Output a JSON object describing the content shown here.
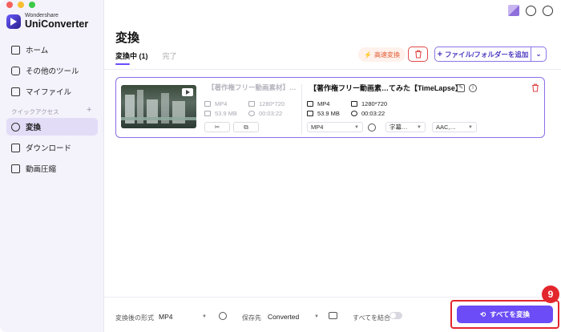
{
  "app": {
    "brand": "Wondershare",
    "product": "UniConverter"
  },
  "colors": {
    "accent": "#6b4cf6",
    "danger": "#e04848",
    "highlight": "#e3262d",
    "fast": "#e15a2f"
  },
  "sidebar": {
    "items": [
      {
        "label": "ホーム",
        "icon": "home-icon"
      },
      {
        "label": "その他のツール",
        "icon": "toolbox-icon"
      },
      {
        "label": "マイファイル",
        "icon": "file-icon"
      },
      {
        "label": "変換",
        "icon": "convert-icon",
        "active": true
      },
      {
        "label": "ダウンロード",
        "icon": "download-icon"
      },
      {
        "label": "動画圧縮",
        "icon": "compress-icon"
      }
    ],
    "section_label": "クイックアクセス",
    "section_add": "+"
  },
  "main": {
    "title": "変換",
    "tabs": [
      {
        "label": "変換中 (1)",
        "active": true
      },
      {
        "label": "完了",
        "active": false
      }
    ],
    "fast_convert_label": "高速変換",
    "add_files_label": "ファイル/フォルダーを追加",
    "add_files_plus": "+",
    "add_files_arrow": "⌄"
  },
  "file": {
    "source": {
      "title": "【著作権フリー動画素材】…",
      "format": "MP4",
      "resolution": "1280*720",
      "size": "53.9 MB",
      "duration": "00:03:22"
    },
    "output": {
      "title": "【著作権フリー動画素…てみた【TimeLapse】",
      "format": "MP4",
      "resolution": "1280*720",
      "size": "53.9 MB",
      "duration": "00:03:22",
      "format_select": "MP4",
      "subtitle_select": "字幕…",
      "audio_select": "AAC,…"
    }
  },
  "bottom": {
    "output_format_label": "変換後の形式",
    "output_format_value": "MP4",
    "save_to_label": "保存先",
    "save_to_value": "Converted",
    "merge_label": "すべてを結合",
    "merge_enabled": false,
    "convert_all_label": "すべてを変換"
  },
  "annotation": {
    "step": "9"
  }
}
